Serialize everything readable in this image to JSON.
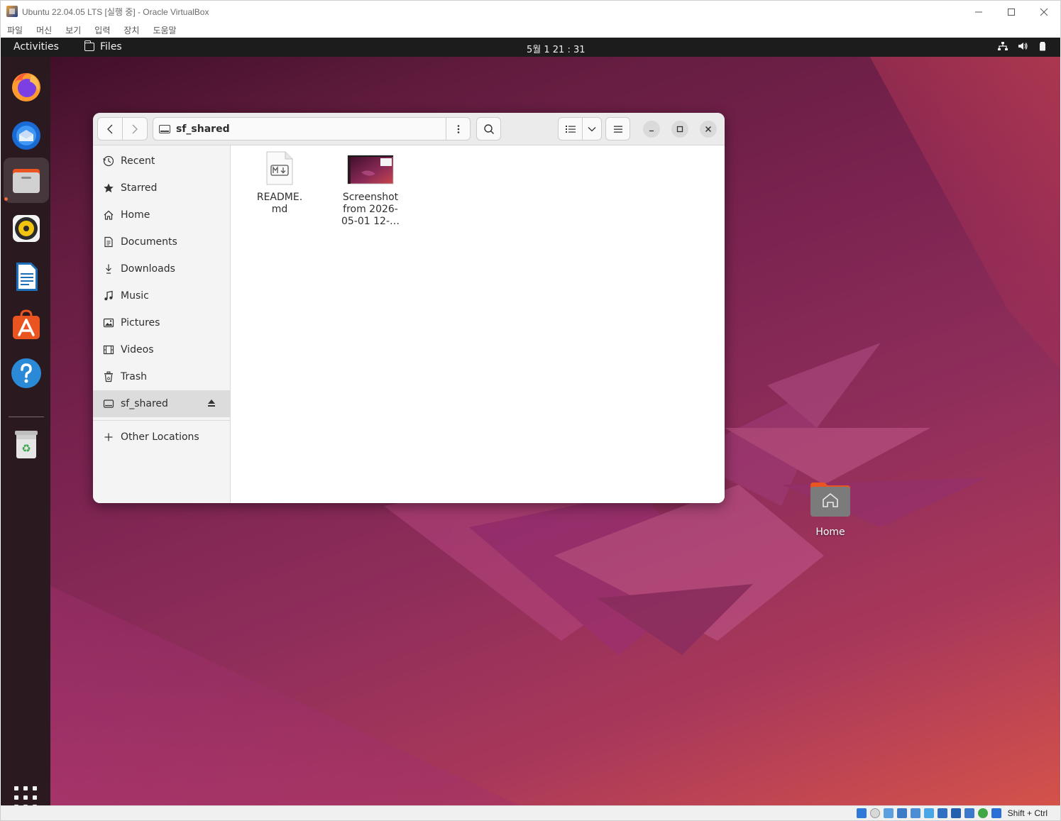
{
  "vbox": {
    "title": "Ubuntu 22.04.05 LTS [실행 중] - Oracle VirtualBox",
    "menu": [
      "파일",
      "머신",
      "보기",
      "입력",
      "장치",
      "도움말"
    ],
    "statusbar": {
      "host_key": "Shift + Ctrl"
    }
  },
  "topbar": {
    "activities": "Activities",
    "app_name": "Files",
    "clock": "5월 1  21 : 31"
  },
  "dock": {
    "apps": [
      "firefox-icon",
      "thunderbird-icon",
      "files-icon",
      "rhythmbox-icon",
      "libreoffice-writer-icon",
      "app-center-icon",
      "help-icon",
      "trash-icon"
    ],
    "active_app": "files-icon"
  },
  "desktop": {
    "home_label": "Home"
  },
  "nautilus": {
    "path": "sf_shared",
    "sidebar": [
      {
        "label": "Recent",
        "icon": "clock-icon"
      },
      {
        "label": "Starred",
        "icon": "star-icon"
      },
      {
        "label": "Home",
        "icon": "home-icon"
      },
      {
        "label": "Documents",
        "icon": "document-icon"
      },
      {
        "label": "Downloads",
        "icon": "download-icon"
      },
      {
        "label": "Music",
        "icon": "music-icon"
      },
      {
        "label": "Pictures",
        "icon": "picture-icon"
      },
      {
        "label": "Videos",
        "icon": "video-icon"
      },
      {
        "label": "Trash",
        "icon": "trash-icon"
      },
      {
        "label": "sf_shared",
        "icon": "drive-icon",
        "selected": true,
        "eject": true
      }
    ],
    "other_locations": "Other Locations",
    "files": [
      {
        "name_line1": "README.",
        "name_line2": "md",
        "name_line3": "",
        "type": "markdown"
      },
      {
        "name_line1": "Screenshot",
        "name_line2": "from 2026-",
        "name_line3": "05-01 12-…",
        "type": "image"
      }
    ]
  },
  "colors": {
    "ubuntu_orange": "#e95420",
    "topbar_bg": "#1c1c1c",
    "dock_bg": "#2a1a20"
  }
}
